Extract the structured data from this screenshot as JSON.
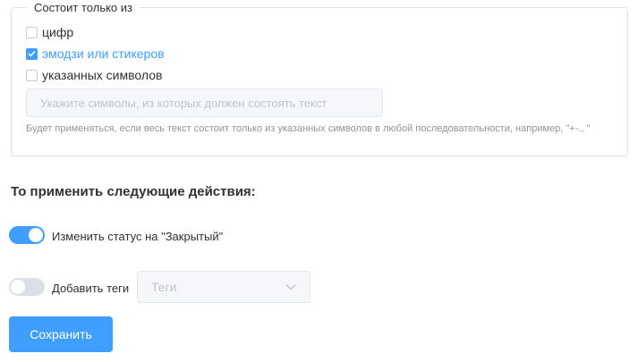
{
  "filter": {
    "legend": "Состоит только из",
    "options": [
      {
        "label": "цифр",
        "checked": false
      },
      {
        "label": "эмодзи или стикеров",
        "checked": true
      },
      {
        "label": "указанных символов",
        "checked": false
      }
    ],
    "symbols_placeholder": "Укажите символы, из которых должен состоять текст",
    "hint": "Будет применяться, если весь текст состоит только из указанных символов в любой последовательности, например, \"+-., \""
  },
  "actions": {
    "title": "То применить следующие действия:",
    "change_status": {
      "label": "Изменить статус на \"Закрытый\"",
      "enabled": true
    },
    "add_tags": {
      "label": "Добавить теги",
      "enabled": false,
      "select_placeholder": "Теги"
    }
  },
  "save_label": "Сохранить",
  "colors": {
    "accent": "#409eff",
    "muted": "#909399",
    "border": "#dcdfe6"
  }
}
